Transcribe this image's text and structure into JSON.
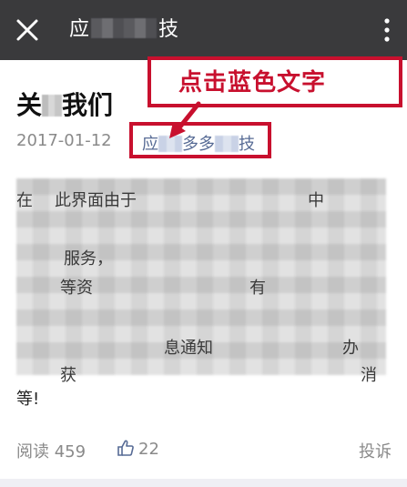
{
  "topbar": {
    "title_left": "应",
    "title_right": "技",
    "close_icon": "close-icon",
    "more_icon": "more-vertical-icon"
  },
  "annotation": {
    "text": "点击蓝色文字",
    "color": "#c8102e"
  },
  "article": {
    "title_left": "关",
    "title_right": "我们",
    "date": "2017-01-12",
    "account_left": "应",
    "account_mid": "多多",
    "account_right": "技",
    "account_color": "#576b95",
    "body_fragments": [
      "在",
      "此界面由于",
      "中",
      "服务，",
      "等资",
      "有",
      "息通知",
      "办",
      "获",
      "消"
    ],
    "body_last_line": "等!"
  },
  "footer": {
    "reads_label": "阅读",
    "reads_count": "459",
    "likes_count": "22",
    "report_label": "投诉"
  }
}
